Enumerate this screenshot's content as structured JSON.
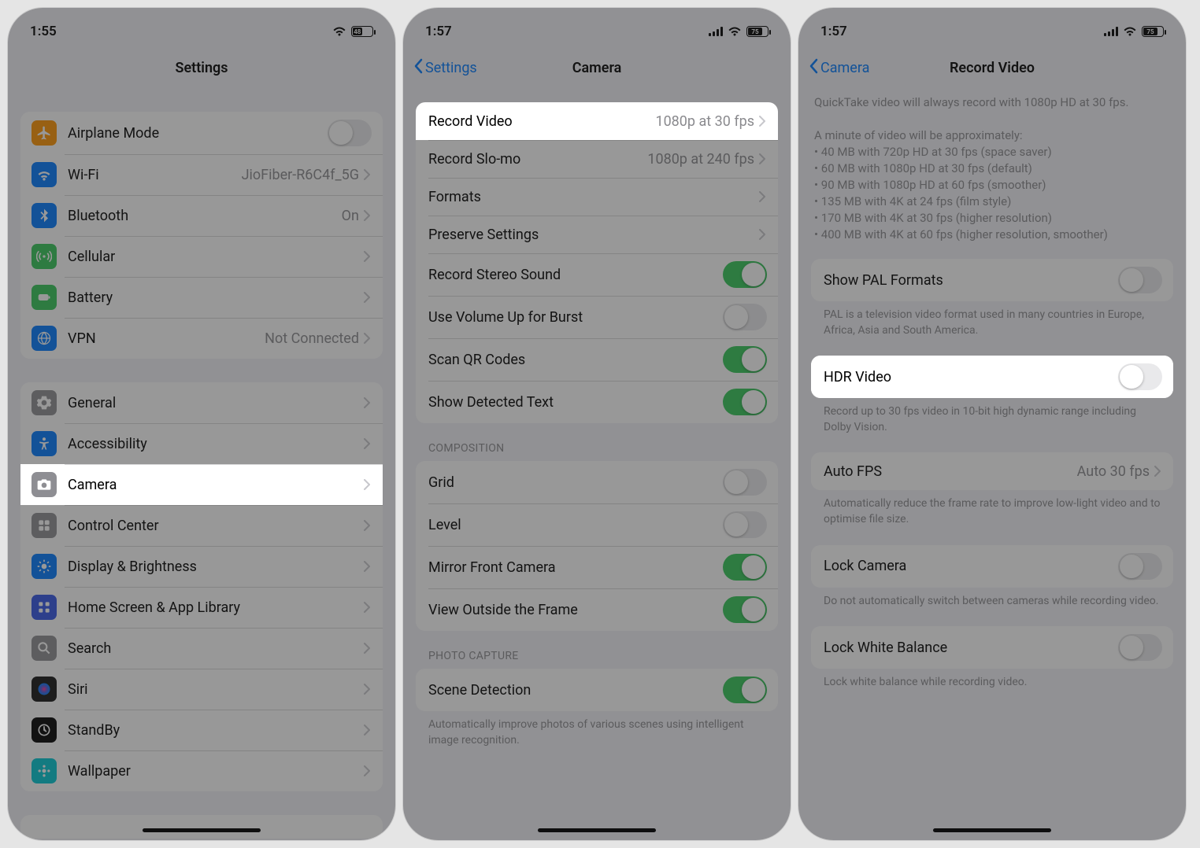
{
  "screen1": {
    "status": {
      "time": "1:55",
      "battery": "48"
    },
    "title": "Settings",
    "group1": [
      {
        "icon": "airplane",
        "bg": "#ff9500",
        "label": "Airplane Mode",
        "toggle": false
      },
      {
        "icon": "wifi",
        "bg": "#007aff",
        "label": "Wi-Fi",
        "value": "JioFiber-R6C4f_5G"
      },
      {
        "icon": "bluetooth",
        "bg": "#007aff",
        "label": "Bluetooth",
        "value": "On"
      },
      {
        "icon": "cellular",
        "bg": "#34c759",
        "label": "Cellular"
      },
      {
        "icon": "battery",
        "bg": "#34c759",
        "label": "Battery"
      },
      {
        "icon": "vpn",
        "bg": "#007aff",
        "label": "VPN",
        "value": "Not Connected"
      }
    ],
    "group2": [
      {
        "icon": "gear",
        "bg": "#8e8e93",
        "label": "General"
      },
      {
        "icon": "accessibility",
        "bg": "#007aff",
        "label": "Accessibility"
      },
      {
        "icon": "camera",
        "bg": "#8e8e93",
        "label": "Camera",
        "highlight": true
      },
      {
        "icon": "control",
        "bg": "#8e8e93",
        "label": "Control Center"
      },
      {
        "icon": "display",
        "bg": "#007aff",
        "label": "Display & Brightness"
      },
      {
        "icon": "home",
        "bg": "#3355e6",
        "label": "Home Screen & App Library"
      },
      {
        "icon": "search",
        "bg": "#8e8e93",
        "label": "Search"
      },
      {
        "icon": "siri",
        "bg": "#151515",
        "label": "Siri"
      },
      {
        "icon": "standby",
        "bg": "#000000",
        "label": "StandBy"
      },
      {
        "icon": "wallpaper",
        "bg": "#00c7d4",
        "label": "Wallpaper"
      }
    ]
  },
  "screen2": {
    "status": {
      "time": "1:57",
      "battery": "75"
    },
    "back": "Settings",
    "title": "Camera",
    "group1": [
      {
        "label": "Record Video",
        "value": "1080p at 30 fps",
        "highlight": true
      },
      {
        "label": "Record Slo-mo",
        "value": "1080p at 240 fps"
      },
      {
        "label": "Formats"
      },
      {
        "label": "Preserve Settings"
      },
      {
        "label": "Record Stereo Sound",
        "toggle": true
      },
      {
        "label": "Use Volume Up for Burst",
        "toggle": false
      },
      {
        "label": "Scan QR Codes",
        "toggle": true
      },
      {
        "label": "Show Detected Text",
        "toggle": true
      }
    ],
    "header_comp": "COMPOSITION",
    "group2": [
      {
        "label": "Grid",
        "toggle": false
      },
      {
        "label": "Level",
        "toggle": false
      },
      {
        "label": "Mirror Front Camera",
        "toggle": true
      },
      {
        "label": "View Outside the Frame",
        "toggle": true
      }
    ],
    "header_photo": "PHOTO CAPTURE",
    "group3": [
      {
        "label": "Scene Detection",
        "toggle": true
      }
    ],
    "footer_scene": "Automatically improve photos of various scenes using intelligent image recognition."
  },
  "screen3": {
    "status": {
      "time": "1:57",
      "battery": "75"
    },
    "back": "Camera",
    "title": "Record Video",
    "info_line0": "QuickTake video will always record with 1080p HD at 30 fps.",
    "info_line1": "A minute of video will be approximately:",
    "bullets": [
      "• 40 MB with 720p HD at 30 fps (space saver)",
      "• 60 MB with 1080p HD at 30 fps (default)",
      "• 90 MB with 1080p HD at 60 fps (smoother)",
      "• 135 MB with 4K at 24 fps (film style)",
      "• 170 MB with 4K at 30 fps (higher resolution)",
      "• 400 MB with 4K at 60 fps (higher resolution, smoother)"
    ],
    "pal_label": "Show PAL Formats",
    "pal_footer": "PAL is a television video format used in many countries in Europe, Africa, Asia and South America.",
    "hdr_label": "HDR Video",
    "hdr_footer": "Record up to 30 fps video in 10-bit high dynamic range including Dolby Vision.",
    "autofps_label": "Auto FPS",
    "autofps_value": "Auto 30 fps",
    "autofps_footer": "Automatically reduce the frame rate to improve low-light video and to optimise file size.",
    "lockcam_label": "Lock Camera",
    "lockcam_footer": "Do not automatically switch between cameras while recording video.",
    "lockwb_label": "Lock White Balance",
    "lockwb_footer": "Lock white balance while recording video."
  }
}
